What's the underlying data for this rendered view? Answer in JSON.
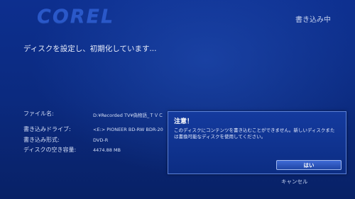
{
  "header": {
    "logo": "COREL",
    "status": "書き込み中"
  },
  "main": {
    "heading": "ディスクを設定し、初期化しています...",
    "info": [
      {
        "label": "ファイル名:",
        "value": "D:¥Recorded TV¥偽物語_ＴＶＣ"
      },
      {
        "label": "書き込みドライブ:",
        "value": "<E:>  PIONEER BD-RW   BDR-20"
      },
      {
        "label": "書き込み形式:",
        "value": "DVD-R"
      },
      {
        "label": "ディスクの空き容量:",
        "value": "4474.88 MB"
      }
    ]
  },
  "dialog": {
    "title": "注意！",
    "message": "このディスクにコンテンツを書き込むことができません。新しいディスクまたは書換可能なディスクを使用してください。",
    "ok_label": "はい"
  },
  "footer": {
    "cancel_label": "キャンセル"
  }
}
